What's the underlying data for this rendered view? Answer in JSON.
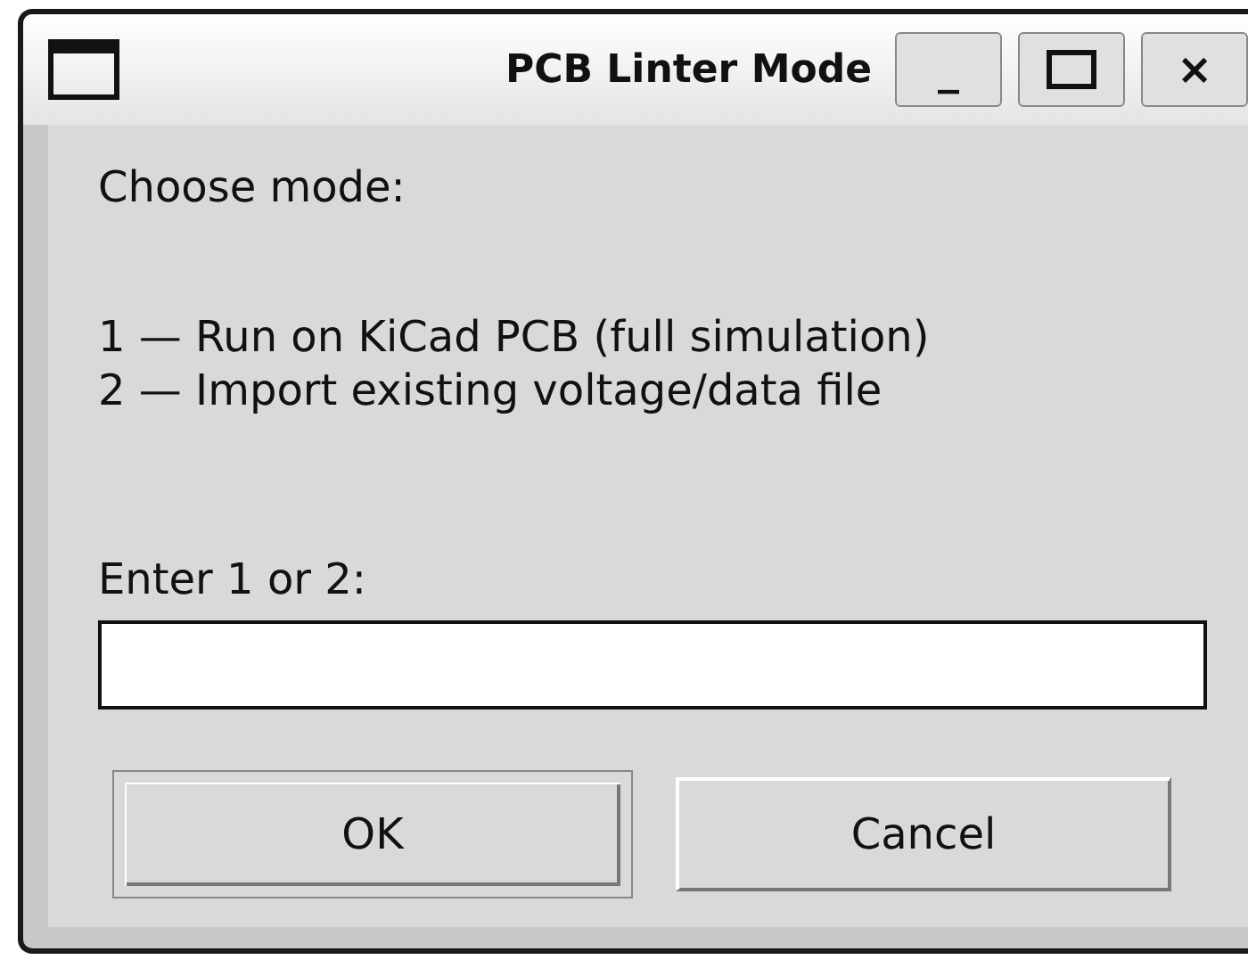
{
  "window": {
    "title": "PCB Linter Mode",
    "controls": [
      {
        "kind": "minimize",
        "label": "_"
      },
      {
        "kind": "maximize"
      },
      {
        "kind": "close",
        "label": "×"
      }
    ]
  },
  "prompt": "Choose mode:",
  "options": [
    "1 — Run on KiCad PCB (full simulation)",
    "2 — Import existing voltage/data file"
  ],
  "entry": {
    "label": "Enter 1 or 2:"
  },
  "buttons": [
    {
      "label": "OK",
      "default": true
    },
    {
      "label": "Cancel",
      "default": false
    }
  ]
}
